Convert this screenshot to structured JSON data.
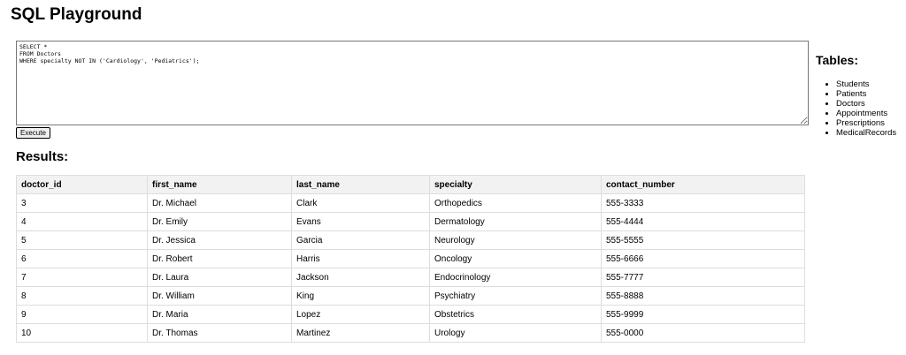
{
  "page": {
    "title": "SQL Playground"
  },
  "editor": {
    "query": "SELECT *\nFROM Doctors\nWHERE specialty NOT IN ('Cardiology', 'Pediatrics');"
  },
  "execute_button": {
    "label": "Execute"
  },
  "results": {
    "heading": "Results:",
    "columns": [
      "doctor_id",
      "first_name",
      "last_name",
      "specialty",
      "contact_number"
    ],
    "rows": [
      [
        "3",
        "Dr. Michael",
        "Clark",
        "Orthopedics",
        "555-3333"
      ],
      [
        "4",
        "Dr. Emily",
        "Evans",
        "Dermatology",
        "555-4444"
      ],
      [
        "5",
        "Dr. Jessica",
        "Garcia",
        "Neurology",
        "555-5555"
      ],
      [
        "6",
        "Dr. Robert",
        "Harris",
        "Oncology",
        "555-6666"
      ],
      [
        "7",
        "Dr. Laura",
        "Jackson",
        "Endocrinology",
        "555-7777"
      ],
      [
        "8",
        "Dr. William",
        "King",
        "Psychiatry",
        "555-8888"
      ],
      [
        "9",
        "Dr. Maria",
        "Lopez",
        "Obstetrics",
        "555-9999"
      ],
      [
        "10",
        "Dr. Thomas",
        "Martinez",
        "Urology",
        "555-0000"
      ]
    ]
  },
  "tables_panel": {
    "heading": "Tables:",
    "items": [
      "Students",
      "Patients",
      "Doctors",
      "Appointments",
      "Prescriptions",
      "MedicalRecords"
    ]
  }
}
